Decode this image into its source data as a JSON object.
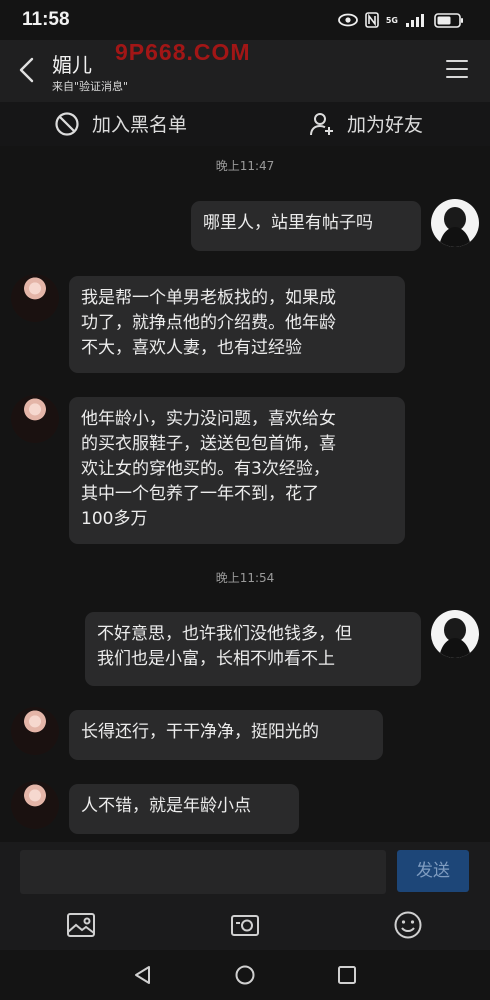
{
  "status": {
    "time": "11:58",
    "network": "5G"
  },
  "header": {
    "title": "媚儿",
    "subtitle": "来自\"验证消息\""
  },
  "actions": {
    "block": "加入黑名单",
    "add_friend": "加为好友"
  },
  "watermark": "9P668.COM",
  "messages": [
    {
      "type": "time",
      "text": "晚上11:47"
    },
    {
      "type": "msg",
      "side": "right",
      "text": "哪里人，站里有帖子吗"
    },
    {
      "type": "msg",
      "side": "left",
      "text": "我是帮一个单男老板找的，如果成\n功了，就挣点他的介绍费。他年龄\n不大，喜欢人妻，也有过经验"
    },
    {
      "type": "msg",
      "side": "left",
      "text": "他年龄小，实力没问题，喜欢给女\n的买衣服鞋子，送送包包首饰，喜\n欢让女的穿他买的。有3次经验，\n其中一个包养了一年不到，花了\n100多万"
    },
    {
      "type": "time",
      "text": "晚上11:54"
    },
    {
      "type": "msg",
      "side": "right",
      "text": "不好意思，也许我们没他钱多，但\n我们也是小富，长相不帅看不上"
    },
    {
      "type": "msg",
      "side": "left",
      "text": "长得还行，干干净净，挺阳光的"
    },
    {
      "type": "msg",
      "side": "left",
      "text": "人不错，就是年龄小点"
    }
  ],
  "input": {
    "placeholder": "",
    "send": "发送"
  }
}
